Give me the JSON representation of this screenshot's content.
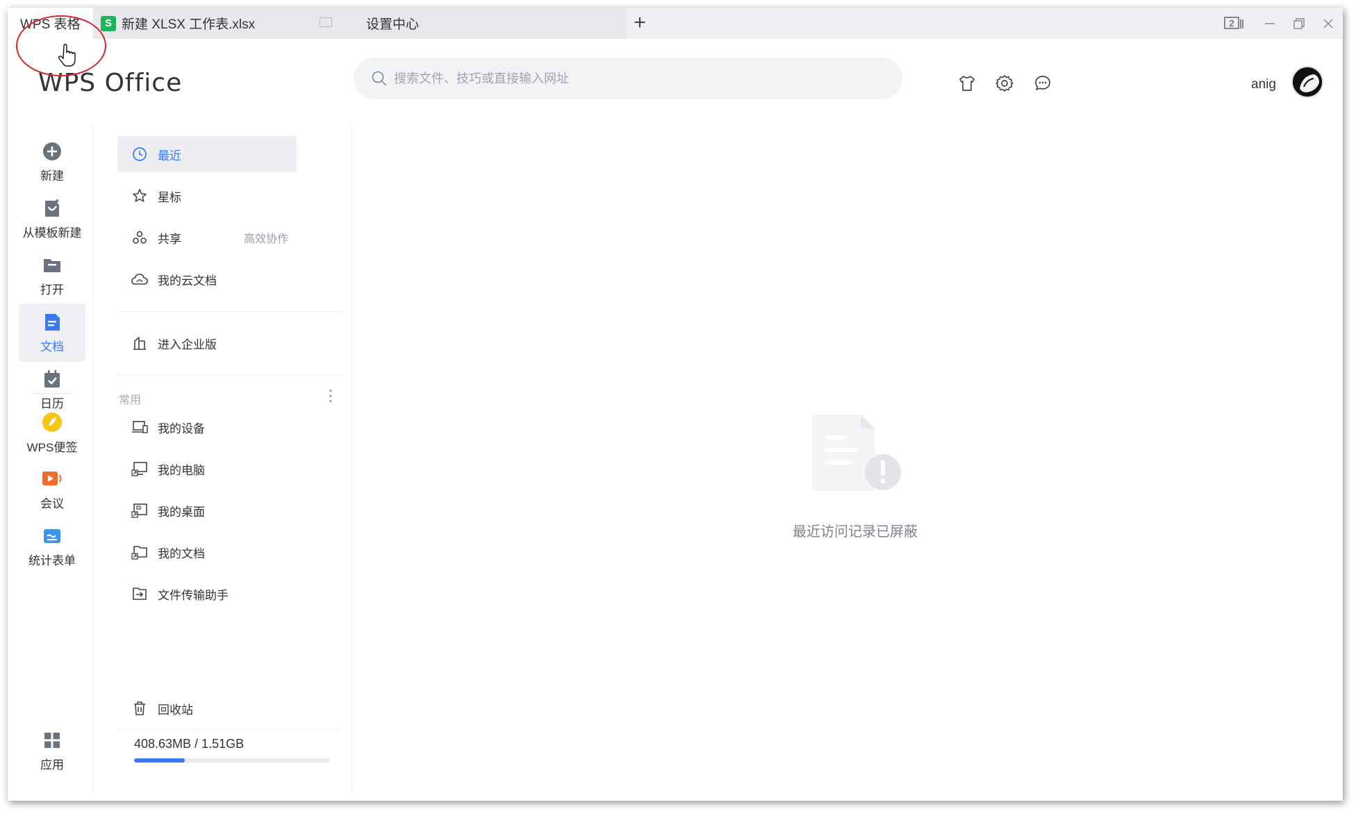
{
  "tabs": [
    {
      "label": "WPS 表格"
    },
    {
      "label": "新建 XLSX 工作表.xlsx"
    },
    {
      "label": "设置中心"
    }
  ],
  "window": {
    "counter": "2"
  },
  "header": {
    "logo": "WPS Office",
    "search_placeholder": "搜索文件、技巧或直接输入网址",
    "username": "anig"
  },
  "rail": [
    {
      "label": "新建",
      "icon": "plus-circle-icon"
    },
    {
      "label": "从模板新建",
      "icon": "template-icon"
    },
    {
      "label": "打开",
      "icon": "folder-icon"
    },
    {
      "label": "文档",
      "icon": "document-icon",
      "active": true
    },
    {
      "label": "日历",
      "icon": "calendar-icon"
    },
    {
      "label": "WPS便签",
      "icon": "note-icon"
    },
    {
      "label": "会议",
      "icon": "meeting-icon"
    },
    {
      "label": "统计表单",
      "icon": "form-icon"
    },
    {
      "label": "应用",
      "icon": "apps-icon"
    }
  ],
  "nav": {
    "recent": "最近",
    "starred": "星标",
    "shared": "共享",
    "shared_hint": "高效协作",
    "cloud": "我的云文档",
    "enterprise": "进入企业版",
    "common_title": "常用",
    "common": [
      "我的设备",
      "我的电脑",
      "我的桌面",
      "我的文档",
      "文件传输助手"
    ],
    "trash": "回收站",
    "storage_text": "408.63MB / 1.51GB",
    "storage_fraction": 0.26
  },
  "main": {
    "empty_message": "最近访问记录已屏蔽"
  },
  "colors": {
    "accent": "#3b78f6",
    "xlsx_green": "#1fb35b",
    "note_yellow": "#f5c518",
    "meeting_orange": "#f26b2a"
  }
}
